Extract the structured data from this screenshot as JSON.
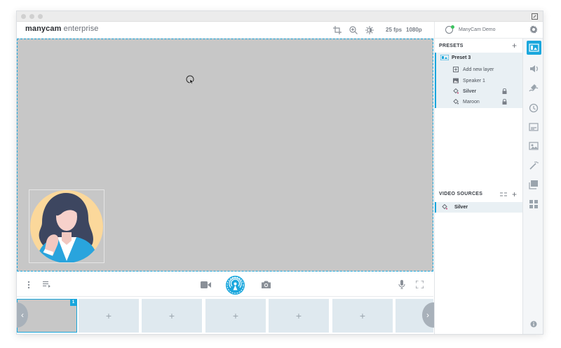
{
  "app": {
    "logo_main": "manycam",
    "logo_sub": "enterprise"
  },
  "toolbar": {
    "fps": "25 fps",
    "resolution": "1080p",
    "user_name": "ManyCam Demo",
    "icons": [
      "crop-icon",
      "zoom-icon",
      "adjust-icon",
      "gear-icon"
    ]
  },
  "presets": {
    "header": "PRESETS",
    "active_preset": "Preset 3",
    "layers": [
      {
        "label": "Add new layer",
        "icon": "add-layer-icon",
        "locked": false
      },
      {
        "label": "Speaker 1",
        "icon": "image-icon",
        "locked": false
      },
      {
        "label": "Silver",
        "icon": "paint-bucket-icon",
        "locked": true
      },
      {
        "label": "Maroon",
        "icon": "paint-bucket-icon",
        "locked": true
      }
    ]
  },
  "video_sources": {
    "header": "VIDEO SOURCES",
    "items": [
      {
        "label": "Silver",
        "icon": "paint-bucket-icon"
      }
    ]
  },
  "thumbnails": {
    "active_number": "1",
    "empty_label": "+"
  },
  "colors": {
    "accent": "#1aa7dd",
    "preview_bg": "#c7c7c7",
    "slot_bg": "#dfe9ef",
    "online": "#3cc35f"
  }
}
